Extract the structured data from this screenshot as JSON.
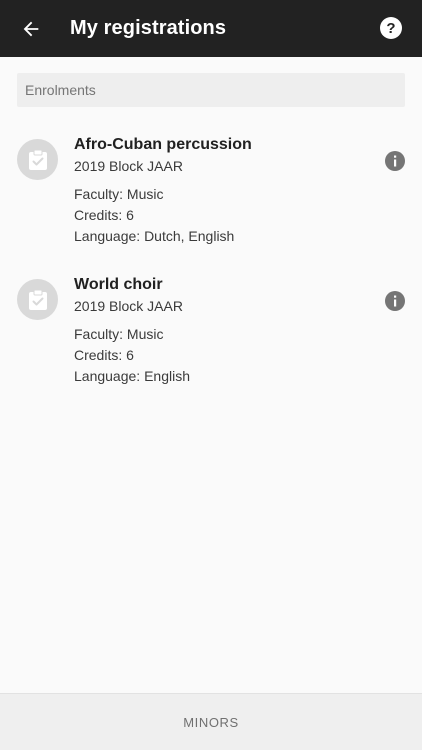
{
  "appbar": {
    "title": "My registrations",
    "back_icon": "arrow-left-icon",
    "help_icon": "help-circle-icon"
  },
  "section": {
    "label": "Enrolments"
  },
  "registrations": [
    {
      "title": "Afro-Cuban percussion",
      "block": "2019 Block JAAR",
      "faculty": "Faculty: Music",
      "credits": "Credits: 6",
      "language": "Language: Dutch, English",
      "avatar_icon": "clipboard-check-icon",
      "info_icon": "info-icon"
    },
    {
      "title": "World choir",
      "block": "2019 Block JAAR",
      "faculty": "Faculty: Music",
      "credits": "Credits: 6",
      "language": "Language: English",
      "avatar_icon": "clipboard-check-icon",
      "info_icon": "info-icon"
    }
  ],
  "bottom": {
    "label": "MINORS"
  },
  "colors": {
    "appbar": "#222222",
    "background": "#fafafa",
    "section_header": "#eeeeee",
    "avatar": "#d9d9d9",
    "info": "#757575",
    "bottom_bar": "#efefef"
  }
}
